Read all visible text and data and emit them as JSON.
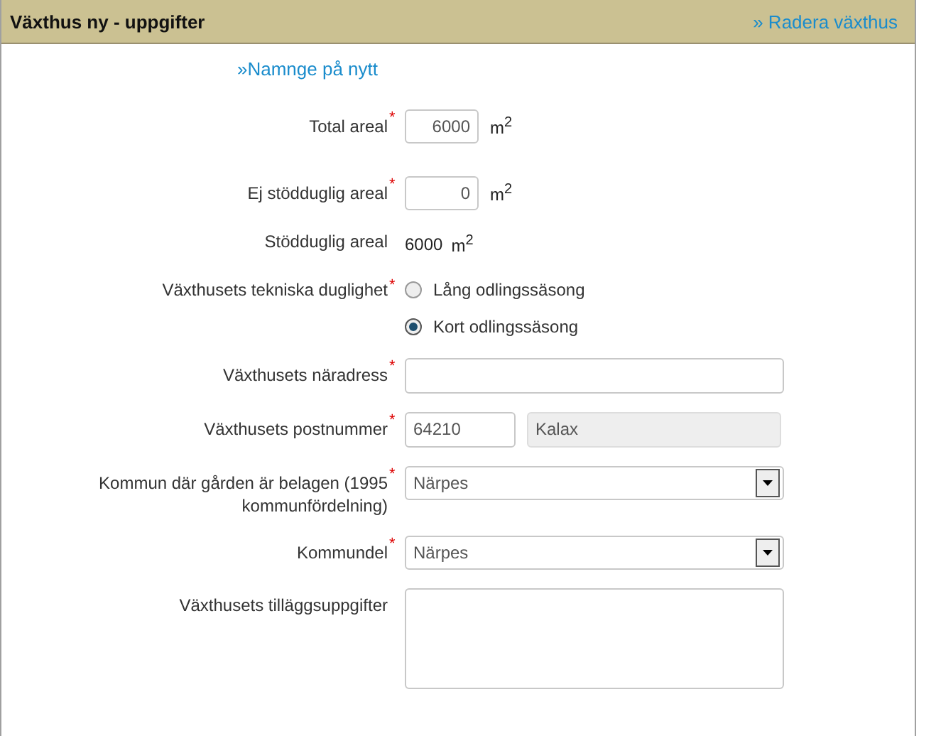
{
  "panel": {
    "title": "Växthus ny - uppgifter",
    "delete_link": "» Radera växthus",
    "rename_link": "»Namnge på nytt"
  },
  "fields": [
    {
      "kind": "number",
      "label": "Total areal",
      "required_mark": "*",
      "value": "6000",
      "unit": "m$^{2}$"
    },
    {
      "kind": "number",
      "label": "Ej stödduglig areal",
      "required_mark": "*",
      "value": "0",
      "unit": "m$^{2}$"
    },
    {
      "kind": "static",
      "label": "Stödduglig areal",
      "value": "6000",
      "unit": "m$^{2}$"
    },
    {
      "kind": "radio",
      "label": "Växthusets tekniska duglighet",
      "required_mark": "*",
      "options": [
        {
          "label": "Lång odlingssäsong",
          "selected": false
        },
        {
          "label": "Kort odlingssäsong",
          "selected": true
        }
      ]
    },
    {
      "kind": "text",
      "label": "Växthusets näradress",
      "required_mark": "*"
    },
    {
      "kind": "postal",
      "label": "Växthusets postnummer",
      "required_mark": "*",
      "value": "64210",
      "city": "Kalax"
    },
    {
      "kind": "select",
      "label": "Kommun där gården är belagen (1995 kommunfördelning)",
      "required_mark": "*",
      "value": "Närpes"
    },
    {
      "kind": "select",
      "label": "Kommundel",
      "required_mark": "*",
      "value": "Närpes"
    },
    {
      "kind": "textarea",
      "label": "Växthusets tilläggsuppgifter"
    }
  ]
}
